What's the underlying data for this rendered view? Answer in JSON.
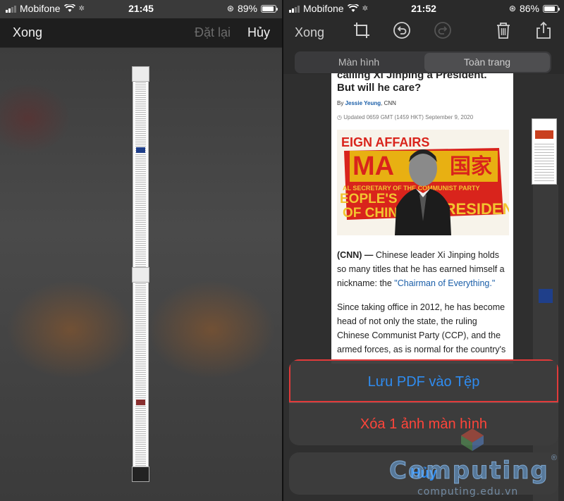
{
  "left": {
    "status": {
      "carrier": "Mobifone",
      "time": "21:45",
      "battery": "89%",
      "battery_level": 0.89
    },
    "toolbar": {
      "done": "Xong",
      "reset": "Đặt lại",
      "cancel": "Hủy"
    }
  },
  "right": {
    "status": {
      "carrier": "Mobifone",
      "time": "21:52",
      "battery": "86%",
      "battery_level": 0.86
    },
    "toolbar": {
      "done": "Xong",
      "icons": [
        "crop-icon",
        "undo-icon",
        "redo-icon",
        "trash-icon",
        "share-icon"
      ]
    },
    "segments": [
      "Màn hình",
      "Toàn trang"
    ],
    "selected_segment": "Toàn trang",
    "article": {
      "headline_line1": "calling Xi Jinping a President.",
      "headline_line2": "But will he care?",
      "by": "By",
      "author": "Jessie Yeung",
      "outlet": ", CNN",
      "updated": "Updated 0659 GMT (1459 HKT) September 9, 2020",
      "photo_text_main": "MA",
      "photo_text_chinese": "国家",
      "photo_text_president": "PRESIDENT",
      "photo_text_top": "EIGN AFFAIRS",
      "photo_text_line": "AL SECRETARY OF THE COMMUNIST PARTY",
      "photo_text_people": "EOPLE'S",
      "photo_text_of_chin": "OF CHIN",
      "body1_lead": "(CNN) —",
      "body1_text": " Chinese leader Xi Jinping holds so many titles that he has earned himself a nickname: the ",
      "body1_link": "\"Chairman of Everything.\"",
      "body2": "Since taking office in 2012, he has become head of not only the state, the ruling Chinese Communist Party (CCP), and the armed forces, as is normal for the country's"
    },
    "sheet": {
      "save_pdf": "Lưu PDF vào Tệp",
      "delete": "Xóa 1 ảnh màn hình",
      "cancel": "Hủy"
    }
  },
  "watermark": {
    "name": "Computing",
    "url": "computing.edu.vn",
    "reg": "®"
  },
  "colors": {
    "accent": "#2f8cf0",
    "destructive": "#ff453a",
    "highlight": "#e23a3a"
  }
}
